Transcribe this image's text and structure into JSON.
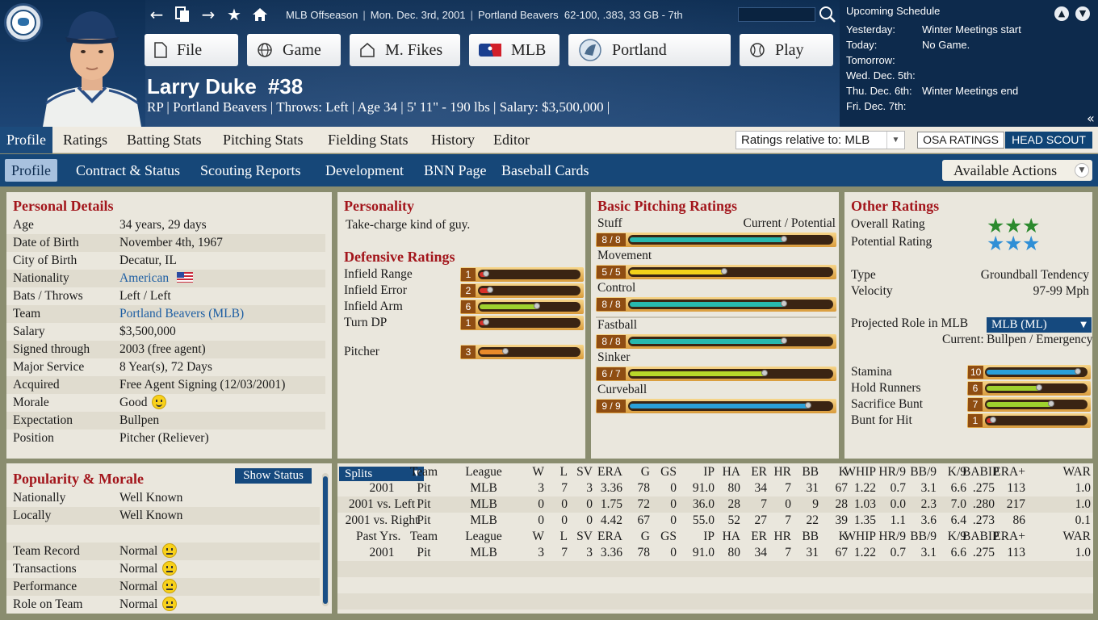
{
  "topbar": {
    "season": "MLB Offseason",
    "date": "Mon. Dec. 3rd, 2001",
    "team": "Portland Beavers",
    "record": "62-100, .383, 33 GB - 7th"
  },
  "menus": [
    {
      "label": "File",
      "icon": "file-icon"
    },
    {
      "label": "Game",
      "icon": "globe-icon"
    },
    {
      "label": "M. Fikes",
      "icon": "home-icon"
    },
    {
      "label": "MLB",
      "icon": "mlb-logo-icon"
    },
    {
      "label": "Portland",
      "icon": "team-logo-icon"
    },
    {
      "label": "Play",
      "icon": "baseball-icon"
    }
  ],
  "player": {
    "name": "Larry Duke",
    "number": "#38",
    "info": "RP | Portland Beavers  |  Throws: Left  |  Age 34  |  5' 11\" - 190 lbs  |  Salary: $3,500,000  |"
  },
  "schedule": {
    "title": "Upcoming Schedule",
    "rows": [
      {
        "day": "Yesterday:",
        "event": "Winter Meetings start"
      },
      {
        "day": "Today:",
        "event": "No Game."
      },
      {
        "day": "Tomorrow:",
        "event": ""
      },
      {
        "day": "Wed. Dec. 5th:",
        "event": ""
      },
      {
        "day": "Thu. Dec. 6th:",
        "event": "Winter Meetings end"
      },
      {
        "day": "Fri. Dec. 7th:",
        "event": ""
      }
    ]
  },
  "tabs1": [
    "Profile",
    "Ratings",
    "Batting Stats",
    "Pitching Stats",
    "Fielding Stats",
    "History",
    "Editor"
  ],
  "ratings_relative": "Ratings relative to: MLB",
  "osa_label": "OSA RATINGS",
  "head_scout_label": "HEAD SCOUT",
  "tabs2": [
    "Profile",
    "Contract & Status",
    "Scouting Reports",
    "Development",
    "BNN Page",
    "Baseball Cards"
  ],
  "available_actions": "Available Actions",
  "personal": {
    "title": "Personal Details",
    "rows": [
      {
        "k": "Age",
        "v": "34 years, 29 days"
      },
      {
        "k": "Date of Birth",
        "v": "November 4th, 1967"
      },
      {
        "k": "City of Birth",
        "v": "Decatur, IL"
      },
      {
        "k": "Nationality",
        "v": "American"
      },
      {
        "k": "Bats / Throws",
        "v": "Left / Left"
      },
      {
        "k": "Team",
        "v": "Portland Beavers (MLB)"
      },
      {
        "k": "Salary",
        "v": "$3,500,000"
      },
      {
        "k": "Signed through",
        "v": "2003 (free agent)"
      },
      {
        "k": "Major Service",
        "v": "8 Year(s), 72 Days"
      },
      {
        "k": "Acquired",
        "v": "Free Agent Signing (12/03/2001)"
      },
      {
        "k": "Morale",
        "v": "Good"
      },
      {
        "k": "Expectation",
        "v": "Bullpen"
      },
      {
        "k": "Position",
        "v": "Pitcher (Reliever)"
      }
    ]
  },
  "personality": {
    "title": "Personality",
    "text": "Take-charge kind of guy."
  },
  "defensive": {
    "title": "Defensive Ratings",
    "items": [
      {
        "label": "Infield Range",
        "value": "1",
        "level": 0.08,
        "color": "#d8312a"
      },
      {
        "label": "Infield Error",
        "value": "2",
        "level": 0.12,
        "color": "#d8312a"
      },
      {
        "label": "Infield Arm",
        "value": "6",
        "level": 0.6,
        "color": "#9ed12e"
      },
      {
        "label": "Turn DP",
        "value": "1",
        "level": 0.08,
        "color": "#d8312a"
      },
      {
        "label": "Pitcher",
        "value": "3",
        "level": 0.28,
        "color": "#e88a2a"
      }
    ]
  },
  "pitching": {
    "title": "Basic Pitching Ratings",
    "header": "Current / Potential",
    "items": [
      {
        "label": "Stuff",
        "value": "8 / 8",
        "level": 0.78,
        "color": "#27b8ae"
      },
      {
        "label": "Movement",
        "value": "5 / 5",
        "level": 0.48,
        "color": "#f2d21a"
      },
      {
        "label": "Control",
        "value": "8 / 8",
        "level": 0.78,
        "color": "#27b8ae"
      },
      {
        "label": "Fastball",
        "value": "8 / 8",
        "level": 0.78,
        "color": "#27b8ae"
      },
      {
        "label": "Sinker",
        "value": "6 / 7",
        "level": 0.68,
        "color": "#b8d82a"
      },
      {
        "label": "Curveball",
        "value": "9 / 9",
        "level": 0.9,
        "color": "#2a9fd8"
      }
    ]
  },
  "other": {
    "title": "Other Ratings",
    "overall_label": "Overall Rating",
    "potential_label": "Potential Rating",
    "overall_stars": 3,
    "potential_stars": 3,
    "type_label": "Type",
    "type_value": "Groundball Tendency",
    "velocity_label": "Velocity",
    "velocity_value": "97-99 Mph",
    "proj_label": "Projected Role in MLB",
    "proj_value": "MLB (ML)",
    "current_label": "Current:",
    "current_value": "Bullpen / Emergency",
    "items": [
      {
        "label": "Stamina",
        "value": "10",
        "level": 0.95,
        "color": "#2a9fd8"
      },
      {
        "label": "Hold Runners",
        "value": "6",
        "level": 0.55,
        "color": "#9ed12e"
      },
      {
        "label": "Sacrifice Bunt",
        "value": "7",
        "level": 0.68,
        "color": "#9ed12e"
      },
      {
        "label": "Bunt for Hit",
        "value": "1",
        "level": 0.08,
        "color": "#d8312a"
      }
    ]
  },
  "popularity": {
    "title": "Popularity & Morale",
    "show_status": "Show Status",
    "rows": [
      {
        "k": "Nationally",
        "v": "Well Known",
        "face": false
      },
      {
        "k": "Locally",
        "v": "Well Known",
        "face": false
      },
      {
        "k": "",
        "v": "",
        "face": false
      },
      {
        "k": "Team Record",
        "v": "Normal",
        "face": true
      },
      {
        "k": "Transactions",
        "v": "Normal",
        "face": true
      },
      {
        "k": "Performance",
        "v": "Normal",
        "face": true
      },
      {
        "k": "Role on Team",
        "v": "Normal",
        "face": true
      }
    ]
  },
  "stats": {
    "splits_label": "Splits",
    "columns": [
      "Team",
      "League",
      "W",
      "L",
      "SV",
      "ERA",
      "G",
      "GS",
      "IP",
      "HA",
      "ER",
      "HR",
      "BB",
      "K",
      "WHIP",
      "HR/9",
      "BB/9",
      "K/9",
      "BABIP",
      "ERA+",
      "WAR"
    ],
    "splits": [
      [
        "2001",
        "Pit",
        "MLB",
        "3",
        "7",
        "3",
        "3.36",
        "78",
        "0",
        "91.0",
        "80",
        "34",
        "7",
        "31",
        "67",
        "1.22",
        "0.7",
        "3.1",
        "6.6",
        ".275",
        "113",
        "1.0"
      ],
      [
        "2001 vs. Left",
        "Pit",
        "MLB",
        "0",
        "0",
        "0",
        "1.75",
        "72",
        "0",
        "36.0",
        "28",
        "7",
        "0",
        "9",
        "28",
        "1.03",
        "0.0",
        "2.3",
        "7.0",
        ".280",
        "217",
        "1.0"
      ],
      [
        "2001 vs. Right",
        "Pit",
        "MLB",
        "0",
        "0",
        "0",
        "4.42",
        "67",
        "0",
        "55.0",
        "52",
        "27",
        "7",
        "22",
        "39",
        "1.35",
        "1.1",
        "3.6",
        "6.4",
        ".273",
        "86",
        "0.1"
      ]
    ],
    "past_label": "Past Yrs.",
    "past": [
      [
        "2001",
        "Pit",
        "MLB",
        "3",
        "7",
        "3",
        "3.36",
        "78",
        "0",
        "91.0",
        "80",
        "34",
        "7",
        "31",
        "67",
        "1.22",
        "0.7",
        "3.1",
        "6.6",
        ".275",
        "113",
        "1.0"
      ]
    ]
  }
}
